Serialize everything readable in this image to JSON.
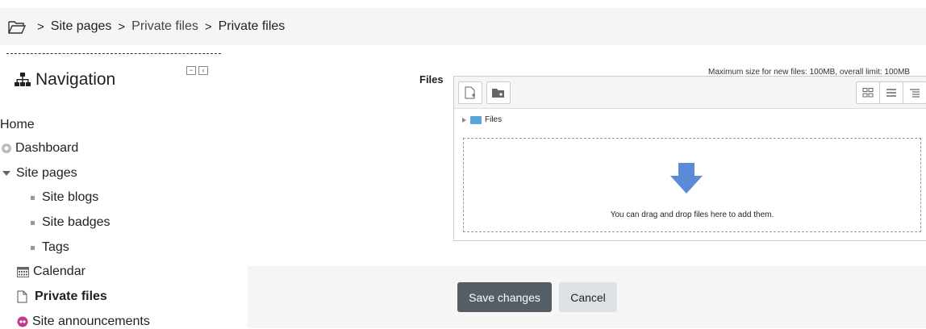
{
  "breadcrumb": {
    "items": [
      "Site pages",
      "Private files",
      "Private files"
    ],
    "separator": ">"
  },
  "navigation": {
    "title": "Navigation",
    "items": [
      {
        "label": "Home",
        "icon": ""
      },
      {
        "label": "Dashboard",
        "icon": "dashboard-icon"
      },
      {
        "label": "Site pages",
        "icon": "caret-down-icon"
      },
      {
        "label": "Site blogs",
        "icon": "bullet-icon"
      },
      {
        "label": "Site badges",
        "icon": "bullet-icon"
      },
      {
        "label": "Tags",
        "icon": "bullet-icon"
      },
      {
        "label": "Calendar",
        "icon": "calendar-icon"
      },
      {
        "label": "Private files",
        "icon": "file-icon"
      },
      {
        "label": "Site announcements",
        "icon": "forum-icon"
      }
    ]
  },
  "files": {
    "label": "Files",
    "max_size": "Maximum size for new files: 100MB, overall limit: 100MB",
    "path_label": "Files",
    "drop_text": "You can drag and drop files here to add them."
  },
  "actions": {
    "save_label": "Save changes",
    "cancel_label": "Cancel"
  },
  "colors": {
    "save_button": "#555e66",
    "cancel_button": "#dee2e6",
    "drop_arrow": "#5b8bd6",
    "forum_icon": "#c0398f"
  }
}
